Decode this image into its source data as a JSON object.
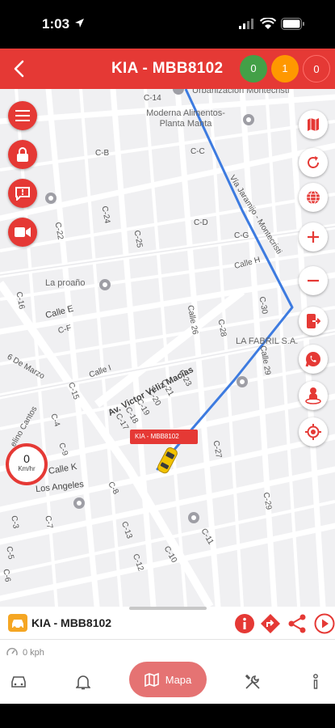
{
  "status_bar": {
    "time": "1:03"
  },
  "header": {
    "title": "KIA - MBB8102",
    "badges": [
      {
        "value": "0",
        "color": "#43a047"
      },
      {
        "value": "1",
        "color": "#ff9800"
      },
      {
        "value": "0",
        "color": "#e53935"
      }
    ],
    "color": "#e53935"
  },
  "map": {
    "street_labels": [
      "C-14",
      "C-B",
      "C-C",
      "C-D",
      "C-25",
      "C-24",
      "C-22",
      "C-16",
      "Calle E",
      "C-F",
      "C-G",
      "Calle H",
      "C-30",
      "C-28",
      "Calle 26",
      "Calle 29",
      "C-23",
      "C-21",
      "C-20",
      "C-19",
      "C-18",
      "C-17",
      "C-15",
      "Calle I",
      "Calle K",
      "C-9",
      "C-7",
      "C-4",
      "C-3",
      "C-5",
      "C-6",
      "C-8",
      "C-10",
      "C-13",
      "C-12",
      "C-11",
      "C-27",
      "C-29"
    ],
    "avenue_label": "Av. Victor Véliz Macías",
    "road_labels": [
      "Vía Jaramijo - Montecristi",
      "6 De Marzo",
      "Los Angeles",
      "elino Cantos"
    ],
    "pois": [
      "Moderna Alimentos-Planta Manta",
      "La proaño",
      "LA FABRIL S.A.",
      "Urbanización Montecristi"
    ],
    "vehicle_tag": "KIA - MBB8102",
    "speed_gauge": {
      "value": "0",
      "unit": "Km/hr"
    },
    "left_buttons": [
      "menu-icon",
      "lock-icon",
      "message-icon",
      "video-icon"
    ],
    "right_buttons": [
      "map-icon",
      "refresh-icon",
      "globe-icon",
      "zoom-in-icon",
      "zoom-out-icon",
      "exit-icon",
      "whatsapp-icon",
      "person-location-icon",
      "target-icon"
    ],
    "route_color": "#3d7be0"
  },
  "bottom_sheet": {
    "vehicle_name": "KIA - MBB8102",
    "speed_text": "0 kph",
    "actions": [
      "info-icon",
      "directions-icon",
      "share-icon",
      "play-icon"
    ]
  },
  "nav": {
    "active_label": "Mapa",
    "items": [
      "car-icon",
      "bell-icon",
      "map-icon",
      "tools-icon",
      "more-icon"
    ]
  }
}
